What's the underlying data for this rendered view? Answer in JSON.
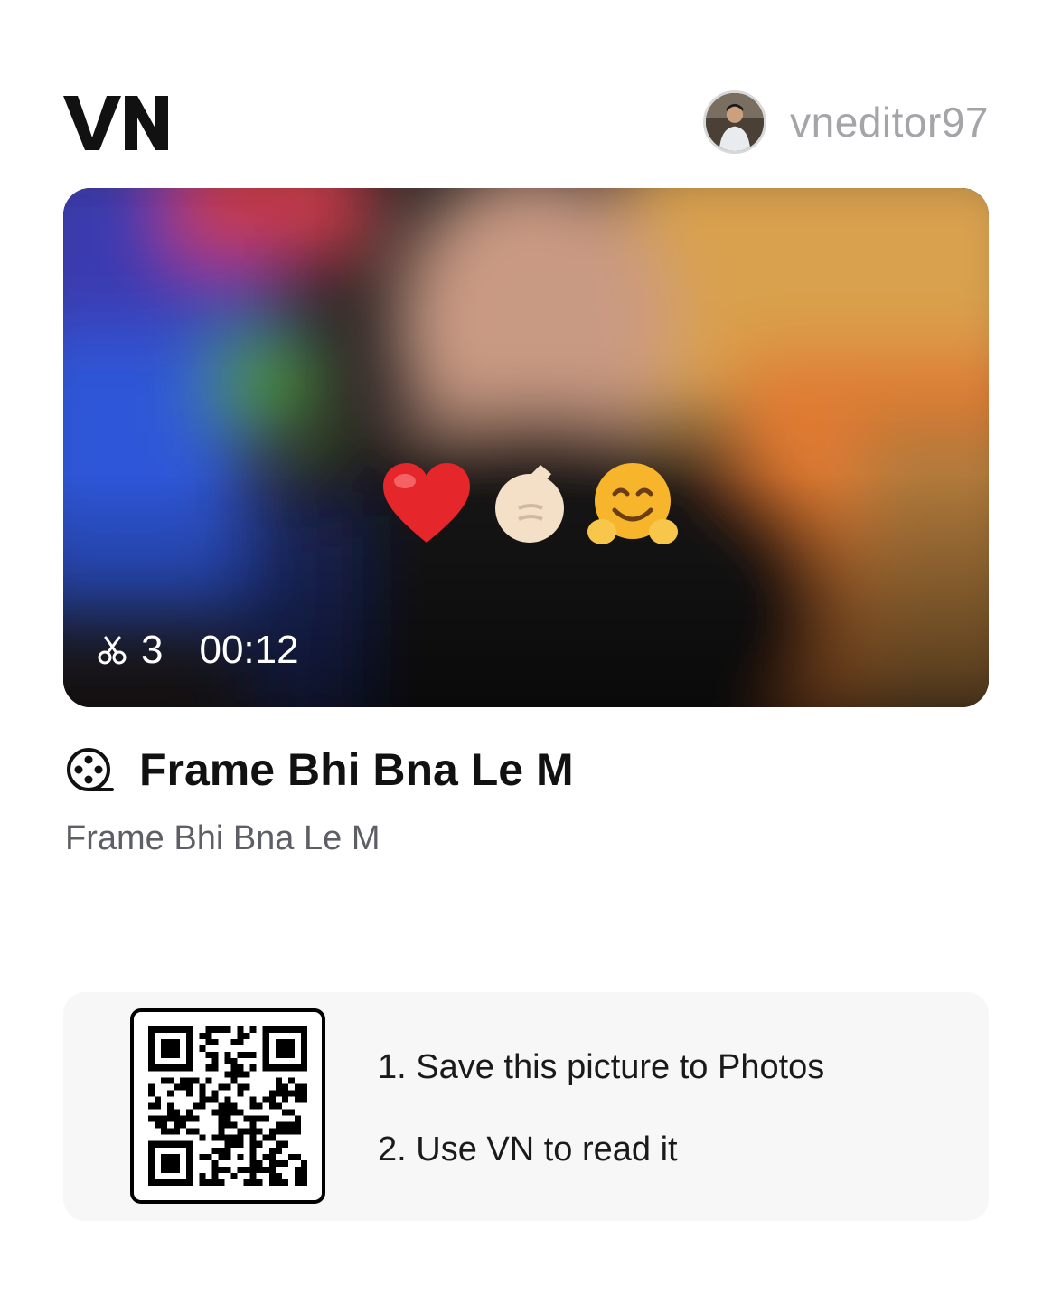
{
  "header": {
    "logo_text": "VN",
    "username": "vneditor97"
  },
  "video": {
    "emojis": [
      "❤️",
      "👉",
      "🤗"
    ],
    "clip_count": "3",
    "duration": "00:12"
  },
  "project": {
    "title": "Frame Bhi Bna Le M",
    "description": "Frame Bhi Bna Le M"
  },
  "qr": {
    "steps": [
      "1. Save this picture to Photos",
      "2. Use VN to read it"
    ]
  },
  "colors": {
    "accent_text": "#111111",
    "muted_text": "#a4a4a9",
    "card_bg": "#f7f7f7"
  }
}
